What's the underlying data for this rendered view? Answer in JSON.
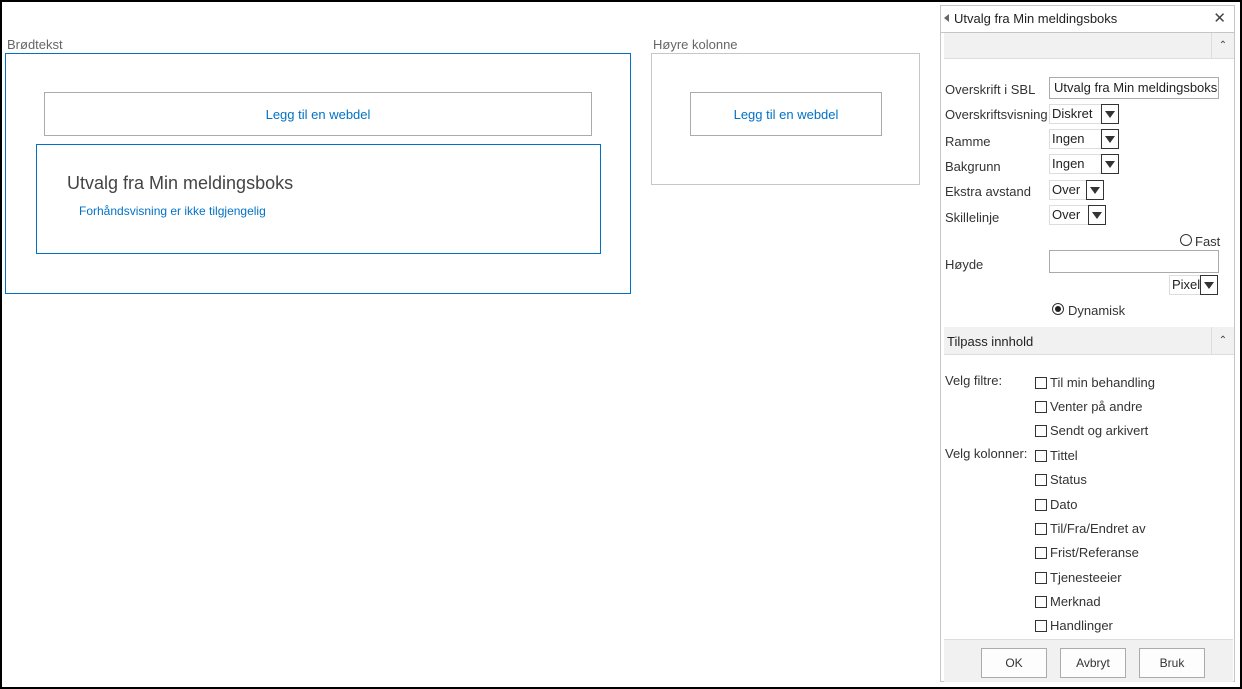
{
  "zones": {
    "body": {
      "label": "Brødtekst",
      "add_webpart": "Legg til en webdel",
      "webpart": {
        "title": "Utvalg fra Min meldingsboks",
        "preview_link": "Forhåndsvisning er ikke tilgjengelig"
      }
    },
    "right": {
      "label": "Høyre kolonne",
      "add_webpart": "Legg til en webdel"
    }
  },
  "toolpane": {
    "title": "Utvalg fra Min meldingsboks",
    "close_glyph": "✕",
    "collapse_glyph": "⌃",
    "appearance": {
      "heading_label": "Overskrift i SBL",
      "heading_value": "Utvalg fra Min meldingsboks",
      "chrome_label": "Overskriftsvisning",
      "chrome_value": "Diskret",
      "border_label": "Ramme",
      "border_value": "Ingen",
      "background_label": "Bakgrunn",
      "background_value": "Ingen",
      "spacing_label": "Ekstra avstand",
      "spacing_value": "Over",
      "divider_label": "Skillelinje",
      "divider_value": "Over",
      "height_label": "Høyde",
      "height_fixed_label": "Fast",
      "height_value": "",
      "height_unit": "Pixel",
      "height_dynamic_label": "Dynamisk"
    },
    "content_section": {
      "title": "Tilpass innhold",
      "filters_label": "Velg filtre:",
      "filters": [
        "Til min behandling",
        "Venter på andre",
        "Sendt og arkivert"
      ],
      "columns_label": "Velg kolonner:",
      "columns": [
        "Tittel",
        "Status",
        "Dato",
        "Til/Fra/Endret av",
        "Frist/Referanse",
        "Tjenesteeier",
        "Merknad",
        "Handlinger"
      ]
    },
    "buttons": {
      "ok": "OK",
      "cancel": "Avbryt",
      "apply": "Bruk"
    }
  }
}
